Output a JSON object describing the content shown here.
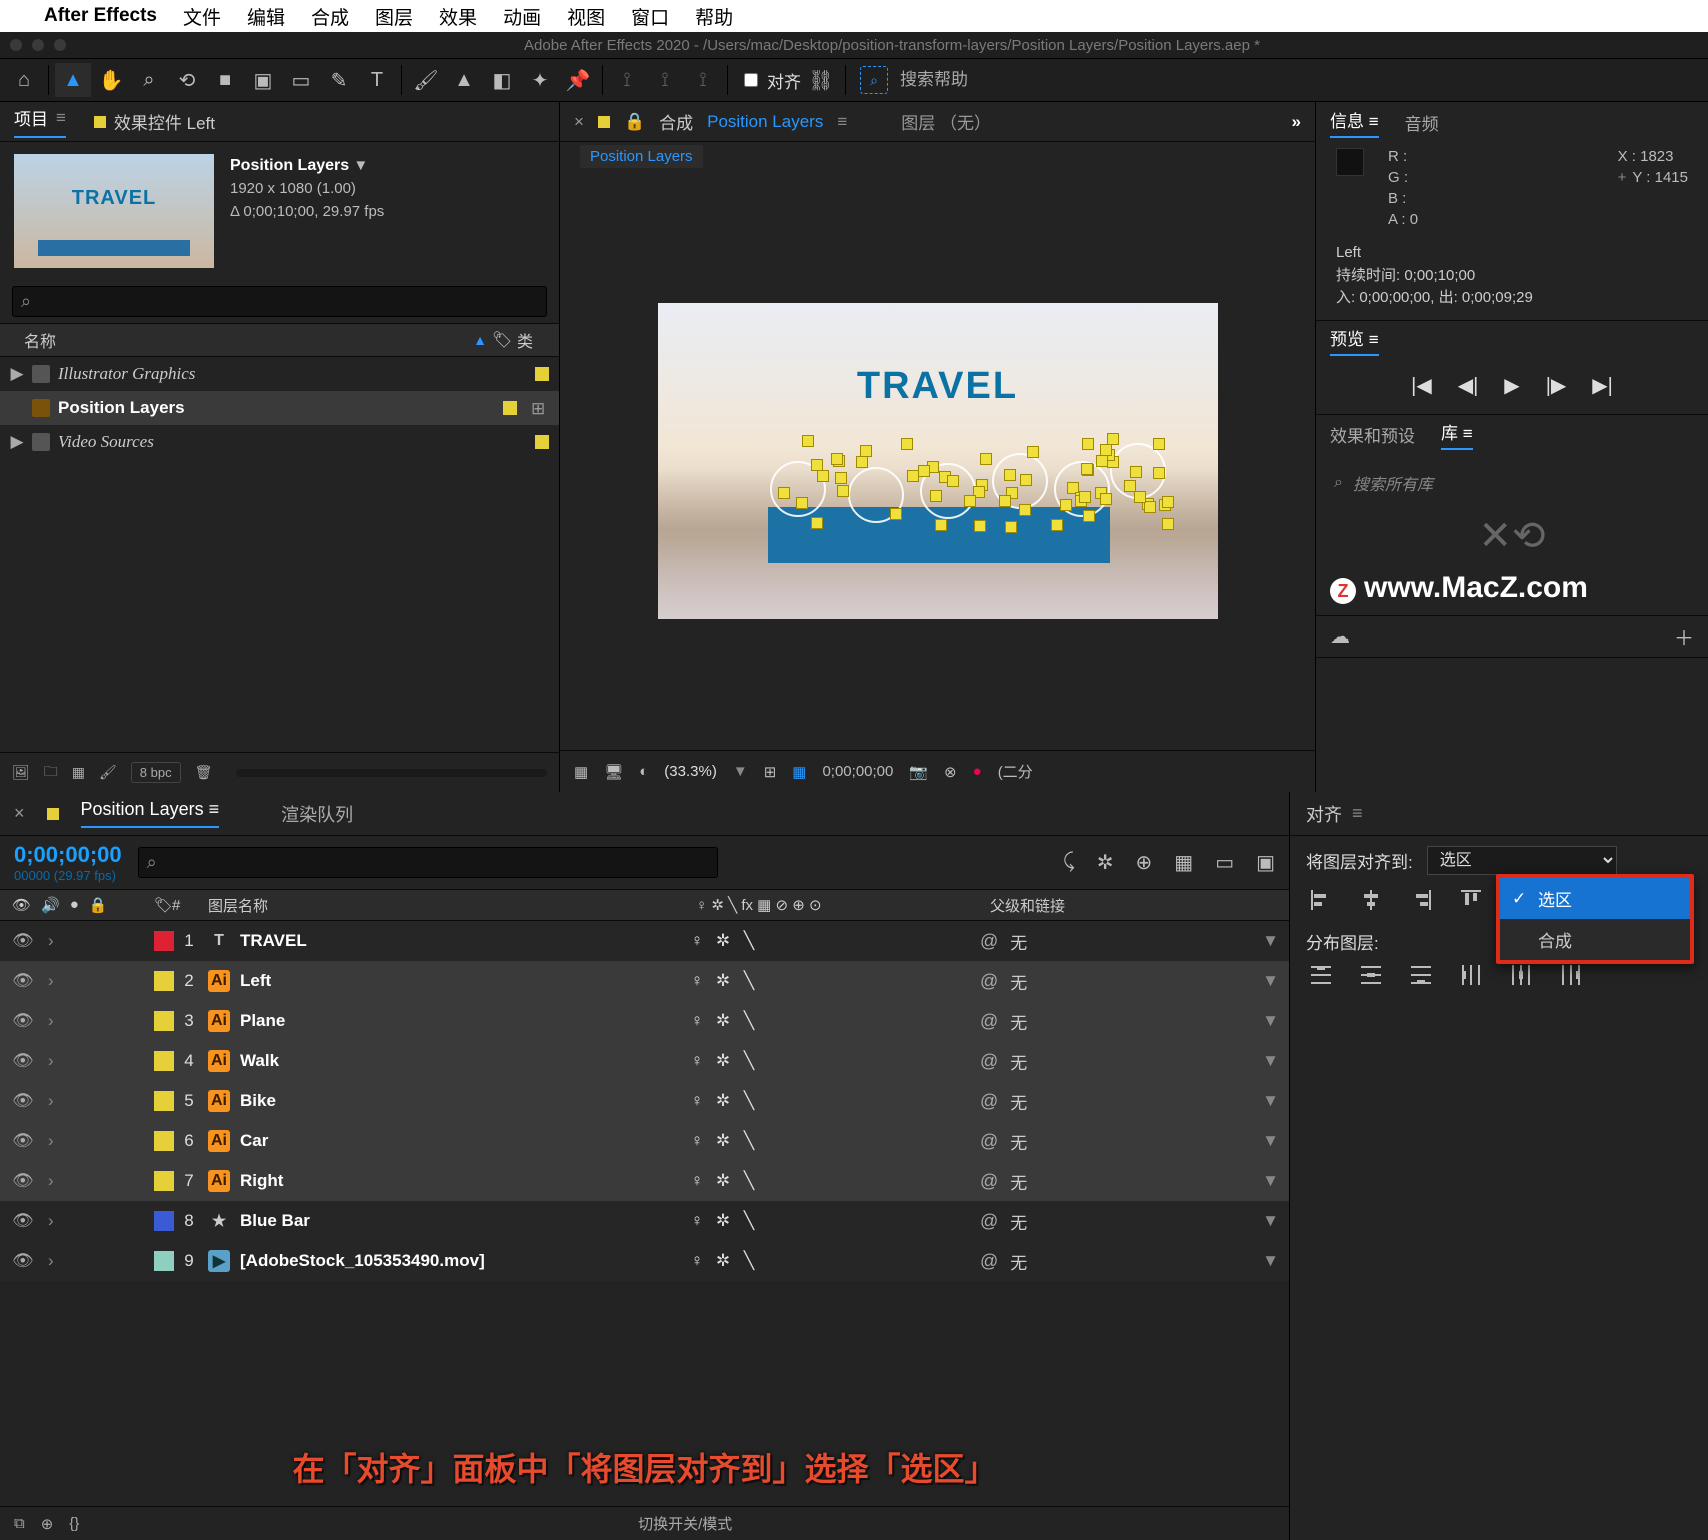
{
  "menubar": {
    "apple": "",
    "app": "After Effects",
    "items": [
      "文件",
      "编辑",
      "合成",
      "图层",
      "效果",
      "动画",
      "视图",
      "窗口",
      "帮助"
    ]
  },
  "titlebar": "Adobe After Effects 2020 - /Users/mac/Desktop/position-transform-layers/Position Layers/Position Layers.aep *",
  "toolbar": {
    "snap": "对齐",
    "search_placeholder": "搜索帮助"
  },
  "project": {
    "tab_project": "项目",
    "tab_fx": "效果控件 Left",
    "name": "Position Layers",
    "menu_arrow": "▼",
    "dims": "1920 x 1080 (1.00)",
    "dur": "Δ 0;00;10;00, 29.97 fps",
    "search": "⌕",
    "head_name": "名称",
    "head_tag": "🏷",
    "head_type": "类",
    "tree": [
      {
        "tw": "▶",
        "type": "folder",
        "name": "Illustrator Graphics",
        "sel": false
      },
      {
        "tw": "",
        "type": "comp",
        "name": "Position Layers",
        "sel": true,
        "flow": true
      },
      {
        "tw": "▶",
        "type": "folder",
        "name": "Video Sources",
        "sel": false
      }
    ],
    "foot": {
      "bpc": "8 bpc"
    }
  },
  "comp": {
    "tab_label": "合成",
    "tab_name": "Position Layers",
    "layer_tab": "图层  （无）",
    "crumb": "Position Layers",
    "canvas_text": "TRAVEL",
    "foot": {
      "zoom": "(33.3%)",
      "time": "0;00;00;00",
      "res": "(二分",
      "res_arrow": "▼"
    }
  },
  "right": {
    "info": {
      "tab_info": "信息",
      "tab_audio": "音频",
      "r": "R :",
      "g": "G :",
      "b": "B :",
      "a": "A :",
      "aval": "0",
      "x": "X :",
      "xval": "1823",
      "y": "Y :",
      "yval": "1415",
      "plus": "+",
      "name": "Left",
      "dur": "持续时间: 0;00;10;00",
      "inout": "入: 0;00;00;00,  出: 0;00;09;29"
    },
    "preview": {
      "tab": "预览"
    },
    "fxlib": {
      "tab_fx": "效果和预设",
      "tab_lib": "库",
      "search": "搜索所有库"
    },
    "watermark": "www.MacZ.com",
    "clouds": {
      "icon": "☁",
      "plus": "＋"
    }
  },
  "timeline": {
    "tab": "Position Layers",
    "tab2": "渲染队列",
    "timecode": "0;00;00;00",
    "subtc": "00000 (29.97 fps)",
    "search": "⌕",
    "head": {
      "num": "#",
      "name": "图层名称",
      "modes": "♀ ✲ ╲ fx ▦ ⊘ ⊕ ⊙",
      "parent": "父级和链接"
    },
    "layers": [
      {
        "num": 1,
        "color": "#d23",
        "ico": "txt",
        "icochar": "T",
        "name": "TRAVEL",
        "sel": false
      },
      {
        "num": 2,
        "color": "#e6d03a",
        "ico": "ai",
        "icochar": "Ai",
        "name": "Left",
        "sel": true
      },
      {
        "num": 3,
        "color": "#e6d03a",
        "ico": "ai",
        "icochar": "Ai",
        "name": "Plane",
        "sel": true
      },
      {
        "num": 4,
        "color": "#e6d03a",
        "ico": "ai",
        "icochar": "Ai",
        "name": "Walk",
        "sel": true
      },
      {
        "num": 5,
        "color": "#e6d03a",
        "ico": "ai",
        "icochar": "Ai",
        "name": "Bike",
        "sel": true
      },
      {
        "num": 6,
        "color": "#e6d03a",
        "ico": "ai",
        "icochar": "Ai",
        "name": "Car",
        "sel": true
      },
      {
        "num": 7,
        "color": "#e6d03a",
        "ico": "ai",
        "icochar": "Ai",
        "name": "Right",
        "sel": true
      },
      {
        "num": 8,
        "color": "#3b5bd6",
        "ico": "star",
        "icochar": "★",
        "name": "Blue Bar",
        "sel": false
      },
      {
        "num": 9,
        "color": "#8fcfbf",
        "ico": "vid",
        "icochar": "▶",
        "name": "[AdobeStock_105353490.mov]",
        "sel": false
      }
    ],
    "parent_none": "无",
    "switchmode": "切换开关/模式"
  },
  "align": {
    "title": "对齐",
    "align_to": "将图层对齐到:",
    "select_value": "选区",
    "distribute": "分布图层:",
    "dropdown": {
      "opt1": "选区",
      "opt2": "合成"
    }
  },
  "caption": "在「对齐」面板中「将图层对齐到」选择「选区」"
}
